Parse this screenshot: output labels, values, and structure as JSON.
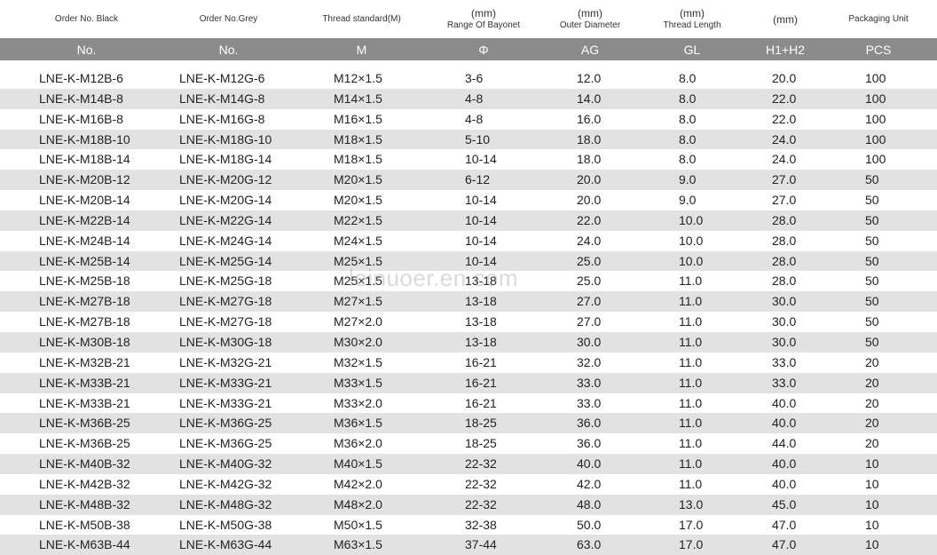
{
  "header": {
    "top": [
      {
        "unit": "",
        "text": "Order No. Black"
      },
      {
        "unit": "",
        "text": "Order No.Grey"
      },
      {
        "unit": "",
        "text": "Thread standard(M)"
      },
      {
        "unit": "(mm)",
        "text": "Range Of Bayonet"
      },
      {
        "unit": "(mm)",
        "text": "Outer Diameter"
      },
      {
        "unit": "(mm)",
        "text": "Thread Length"
      },
      {
        "unit": "(mm)",
        "text": ""
      },
      {
        "unit": "",
        "text": "Packaging Unit"
      }
    ],
    "sub": [
      "No.",
      "No.",
      "M",
      "Φ",
      "AG",
      "GL",
      "H1+H2",
      "PCS"
    ]
  },
  "rows": [
    [
      "LNE-K-M12B-6",
      "LNE-K-M12G-6",
      "M12×1.5",
      "3-6",
      "12.0",
      "8.0",
      "20.0",
      "100"
    ],
    [
      "LNE-K-M14B-8",
      "LNE-K-M14G-8",
      "M14×1.5",
      "4-8",
      "14.0",
      "8.0",
      "22.0",
      "100"
    ],
    [
      "LNE-K-M16B-8",
      "LNE-K-M16G-8",
      "M16×1.5",
      "4-8",
      "16.0",
      "8.0",
      "22.0",
      "100"
    ],
    [
      "LNE-K-M18B-10",
      "LNE-K-M18G-10",
      "M18×1.5",
      "5-10",
      "18.0",
      "8.0",
      "24.0",
      "100"
    ],
    [
      "LNE-K-M18B-14",
      "LNE-K-M18G-14",
      "M18×1.5",
      "10-14",
      "18.0",
      "8.0",
      "24.0",
      "100"
    ],
    [
      "LNE-K-M20B-12",
      "LNE-K-M20G-12",
      "M20×1.5",
      "6-12",
      "20.0",
      "9.0",
      "27.0",
      "50"
    ],
    [
      "LNE-K-M20B-14",
      "LNE-K-M20G-14",
      "M20×1.5",
      "10-14",
      "20.0",
      "9.0",
      "27.0",
      "50"
    ],
    [
      "LNE-K-M22B-14",
      "LNE-K-M22G-14",
      "M22×1.5",
      "10-14",
      "22.0",
      "10.0",
      "28.0",
      "50"
    ],
    [
      "LNE-K-M24B-14",
      "LNE-K-M24G-14",
      "M24×1.5",
      "10-14",
      "24.0",
      "10.0",
      "28.0",
      "50"
    ],
    [
      "LNE-K-M25B-14",
      "LNE-K-M25G-14",
      "M25×1.5",
      "10-14",
      "25.0",
      "10.0",
      "28.0",
      "50"
    ],
    [
      "LNE-K-M25B-18",
      "LNE-K-M25G-18",
      "M25×1.5",
      "13-18",
      "25.0",
      "11.0",
      "28.0",
      "50"
    ],
    [
      "LNE-K-M27B-18",
      "LNE-K-M27G-18",
      "M27×1.5",
      "13-18",
      "27.0",
      "11.0",
      "30.0",
      "50"
    ],
    [
      "LNE-K-M27B-18",
      "LNE-K-M27G-18",
      "M27×2.0",
      "13-18",
      "27.0",
      "11.0",
      "30.0",
      "50"
    ],
    [
      "LNE-K-M30B-18",
      "LNE-K-M30G-18",
      "M30×2.0",
      "13-18",
      "30.0",
      "11.0",
      "30.0",
      "50"
    ],
    [
      "LNE-K-M32B-21",
      "LNE-K-M32G-21",
      "M32×1.5",
      "16-21",
      "32.0",
      "11.0",
      "33.0",
      "20"
    ],
    [
      "LNE-K-M33B-21",
      "LNE-K-M33G-21",
      "M33×1.5",
      "16-21",
      "33.0",
      "11.0",
      "33.0",
      "20"
    ],
    [
      "LNE-K-M33B-21",
      "LNE-K-M33G-21",
      "M33×2.0",
      "16-21",
      "33.0",
      "11.0",
      "40.0",
      "20"
    ],
    [
      "LNE-K-M36B-25",
      "LNE-K-M36G-25",
      "M36×1.5",
      "18-25",
      "36.0",
      "11.0",
      "40.0",
      "20"
    ],
    [
      "LNE-K-M36B-25",
      "LNE-K-M36G-25",
      "M36×2.0",
      "18-25",
      "36.0",
      "11.0",
      "44.0",
      "20"
    ],
    [
      "LNE-K-M40B-32",
      "LNE-K-M40G-32",
      "M40×1.5",
      "22-32",
      "40.0",
      "11.0",
      "40.0",
      "10"
    ],
    [
      "LNE-K-M42B-32",
      "LNE-K-M42G-32",
      "M42×2.0",
      "22-32",
      "42.0",
      "11.0",
      "40.0",
      "10"
    ],
    [
      "LNE-K-M48B-32",
      "LNE-K-M48G-32",
      "M48×2.0",
      "22-32",
      "48.0",
      "13.0",
      "45.0",
      "10"
    ],
    [
      "LNE-K-M50B-38",
      "LNE-K-M50G-38",
      "M50×1.5",
      "32-38",
      "50.0",
      "17.0",
      "47.0",
      "10"
    ],
    [
      "LNE-K-M63B-44",
      "LNE-K-M63G-44",
      "M63×1.5",
      "37-44",
      "63.0",
      "17.0",
      "47.0",
      "10"
    ]
  ],
  "watermark": "leinuoer.en.com",
  "colors": {
    "header_bar": "#8b8b8b",
    "stripe": "#e2e2e2"
  }
}
